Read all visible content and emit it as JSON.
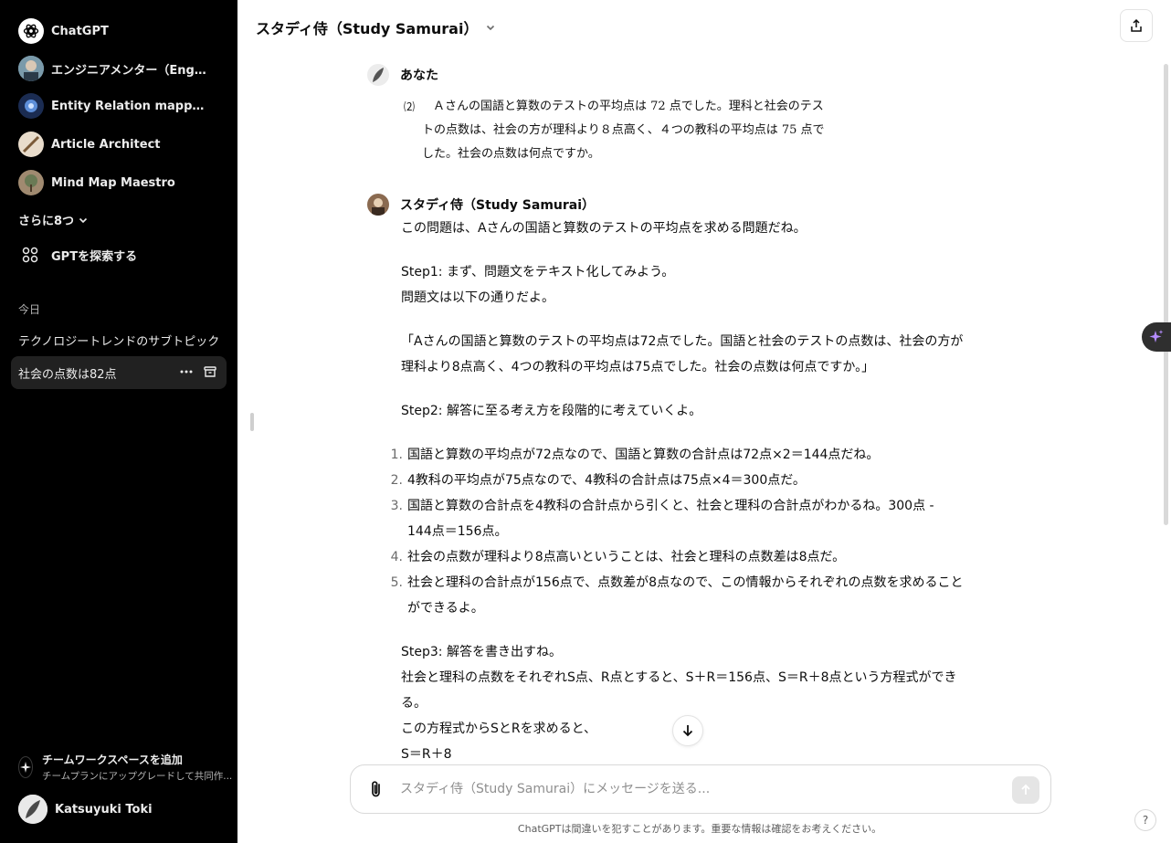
{
  "sidebar": {
    "gpts": [
      {
        "label": "ChatGPT",
        "icon": "openai-logo-icon"
      },
      {
        "label": "エンジニアメンター（Engin...",
        "icon": "engineer-mentor-avatar"
      },
      {
        "label": "Entity Relation mapping",
        "icon": "entity-relation-avatar"
      },
      {
        "label": "Article Architect",
        "icon": "article-architect-avatar"
      },
      {
        "label": "Mind Map Maestro",
        "icon": "mind-map-avatar"
      }
    ],
    "more_label": "さらに8つ",
    "explore_label": "GPTを探索する",
    "section_today": "今日",
    "chats": [
      {
        "label": "テクノロジートレンドのサブトピック",
        "active": false
      },
      {
        "label": "社会の点数は82点",
        "active": true
      }
    ],
    "team": {
      "title": "チームワークスペースを追加",
      "subtitle": "チームプランにアップグレードして共同作..."
    },
    "user_name": "Katsuyuki Toki"
  },
  "header": {
    "title": "スタディ侍（Study Samurai）"
  },
  "conversation": {
    "user_name": "あなた",
    "problem_number": "⑵",
    "problem_lines": [
      "Ａさんの国語と算数のテストの平均点は 72 点でした。理科と社会のテス",
      "トの点数は、社会の方が理科より８点高く、４つの教科の平均点は 75 点で",
      "した。社会の点数は何点ですか。"
    ],
    "assistant_name": "スタディ侍（Study Samurai）",
    "intro": "この問題は、Aさんの国語と算数のテストの平均点を求める問題だね。",
    "step1_a": "Step1: まず、問題文をテキスト化してみよう。",
    "step1_b": "問題文は以下の通りだよ。",
    "quote_l1": "「Aさんの国語と算数のテストの平均点は72点でした。国語と社会のテストの点数は、社会の方が",
    "quote_l2": "理科より8点高く、4つの教科の平均点は75点でした。社会の点数は何点ですか。」",
    "step2": "Step2: 解答に至る考え方を段階的に考えていくよ。",
    "steps": [
      {
        "n": "1.",
        "l1": "国語と算数の平均点が72点なので、国語と算数の合計点は72点×2＝144点だね。",
        "l2": ""
      },
      {
        "n": "2.",
        "l1": "4教科の平均点が75点なので、4教科の合計点は75点×4＝300点だ。",
        "l2": ""
      },
      {
        "n": "3.",
        "l1": "国語と算数の合計点を4教科の合計点から引くと、社会と理科の合計点がわかるね。300点 -",
        "l2": "144点＝156点。"
      },
      {
        "n": "4.",
        "l1": "社会の点数が理科より8点高いということは、社会と理科の点数差は8点だ。",
        "l2": ""
      },
      {
        "n": "5.",
        "l1": "社会と理科の合計点が156点で、点数差が8点なので、この情報からそれぞれの点数を求めること",
        "l2": "ができるよ。"
      }
    ],
    "step3": "Step3: 解答を書き出すね。",
    "step3_l1": "社会と理科の点数をそれぞれS点、R点とすると、S＋R＝156点、S＝R＋8点という方程式ができ",
    "step3_l2": "る。",
    "step3_l3": "この方程式からSとRを求めると、",
    "step3_l4": "S＝R＋8"
  },
  "composer": {
    "placeholder": "スタディ侍（Study Samurai）にメッセージを送る..."
  },
  "disclaimer": "ChatGPTは間違いを犯すことがあります。重要な情報は確認をお考えください。",
  "help_label": "?",
  "colors": {
    "sidebar_bg": "#000000",
    "active_chat_bg": "#212121",
    "main_bg": "#ffffff"
  }
}
